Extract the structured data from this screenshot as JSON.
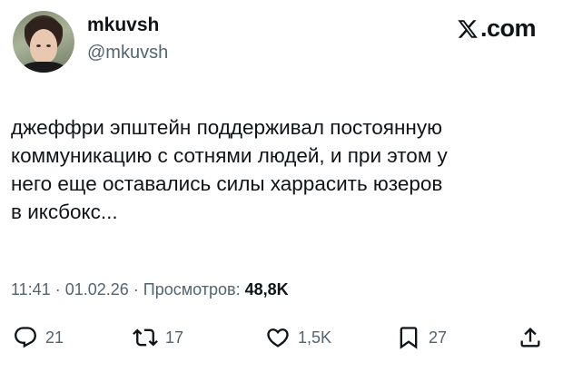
{
  "author": {
    "display_name": "mkuvsh",
    "handle": "@mkuvsh",
    "avatar_icon": "user-avatar-photo"
  },
  "brand": {
    "logo_icon": "x-logo-icon",
    "domain_suffix": ".com"
  },
  "tweet": {
    "text": "джеффри эпштейн поддерживал постоянную\nкоммуникацию с сотнями людей, и при этом у\nнего еще оставались силы харрасить юзеров\nв иксбокс..."
  },
  "meta": {
    "time": "11:41",
    "sep1": " · ",
    "date": "01.02.26",
    "sep2": " · ",
    "views_label": "Просмотров: ",
    "views_count": "48,8K"
  },
  "actions": {
    "reply": {
      "icon": "reply-icon",
      "count": "21"
    },
    "repost": {
      "icon": "repost-icon",
      "count": "17"
    },
    "like": {
      "icon": "heart-icon",
      "count": "1,5K"
    },
    "bookmark": {
      "icon": "bookmark-icon",
      "count": "27"
    },
    "share": {
      "icon": "share-icon"
    }
  },
  "colors": {
    "text": "#0f1419",
    "secondary": "#536471",
    "background": "#ffffff"
  }
}
